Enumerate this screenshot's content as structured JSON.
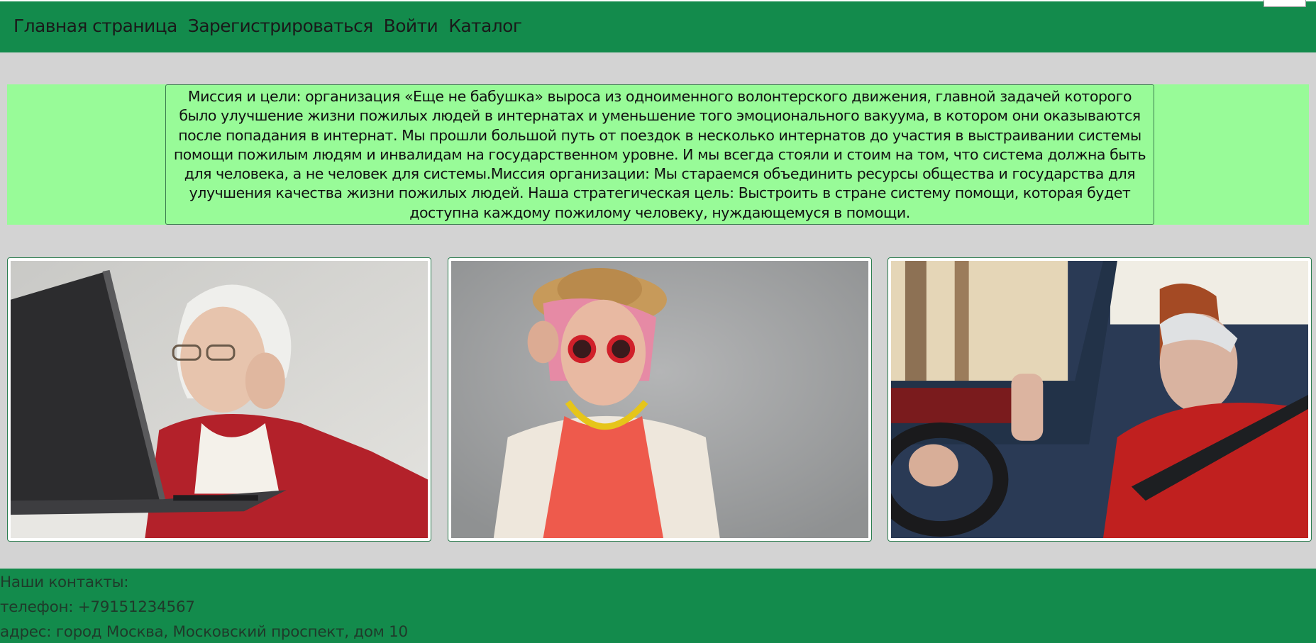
{
  "nav": {
    "items": [
      {
        "label": "Главная страница"
      },
      {
        "label": "Зарегистрироваться"
      },
      {
        "label": "Войти"
      },
      {
        "label": "Каталог"
      }
    ]
  },
  "mission": {
    "text": "Миссия и цели: организация «Еще не бабушка» выроса из одноименного волонтерского движения, главной задачей которого было улучшение жизни пожилых людей в интернатах и уменьшение того эмоционального вакуума, в котором они оказываются после попадания в интернат. Мы прошли большой путь от поездок в несколько интернатов до участия в выстраивании системы помощи пожилым людям и инвалидам на государственном уровне. И мы всегда стояли и стоим на том, что система должна быть для человека, а не человек для системы.Миссия организации: Мы стараемся объединить ресурсы общества и государства для улучшения качества жизни пожилых людей. Наша стратегическая цель: Выстроить в стране систему помощи, которая будет доступна каждому пожилому человеку, нуждающемуся в помощи."
  },
  "gallery": {
    "photos": [
      {
        "name": "elderly-woman-laptop-photo"
      },
      {
        "name": "elderly-woman-sunglasses-photo"
      },
      {
        "name": "elderly-woman-car-photo"
      }
    ]
  },
  "footer": {
    "heading": "Наши контакты:",
    "phone": "телефон: +79151234567",
    "address": "адрес: город Москва, Московский проспект, дом 10"
  },
  "colors": {
    "header_bg": "#138b4c",
    "page_bg": "#d3d3d3",
    "mission_bg": "#98fb98",
    "footer_bg": "#138b4c"
  }
}
